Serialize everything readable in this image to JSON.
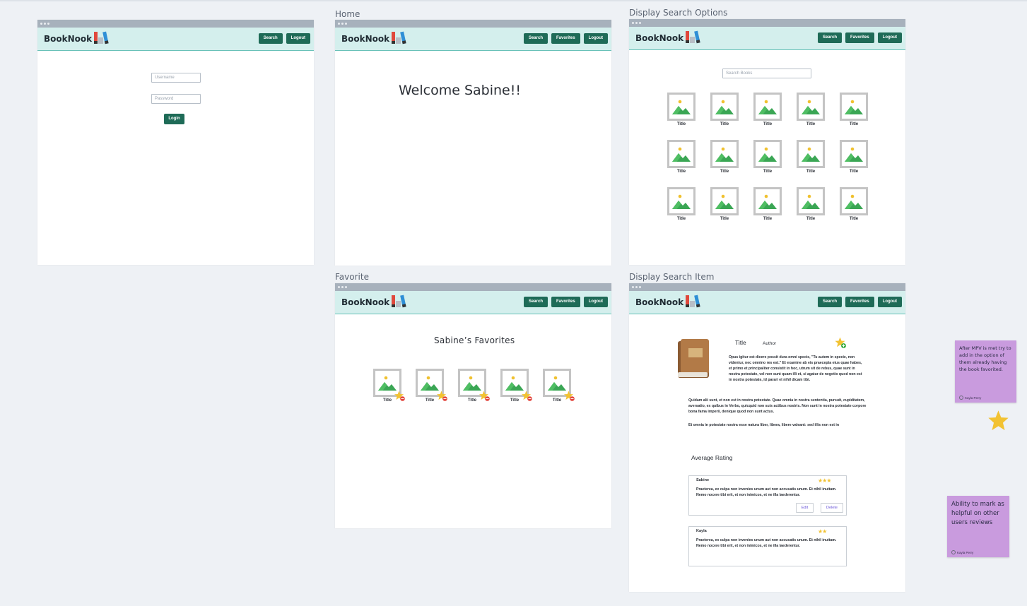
{
  "app": {
    "brand": "BookNook"
  },
  "nav": {
    "search": "Search",
    "favorites": "Favorites",
    "logout": "Logout"
  },
  "frames": {
    "home": "Home",
    "search_options": "Display Search Options",
    "favorite": "Favorite",
    "search_item": "Display Search Item"
  },
  "login": {
    "username_placeholder": "Username",
    "password_placeholder": "Password",
    "button": "Login"
  },
  "home": {
    "welcome": "Welcome Sabine!!"
  },
  "search": {
    "placeholder": "Search Books",
    "titles": [
      "Title",
      "Title",
      "Title",
      "Title",
      "Title",
      "Title",
      "Title",
      "Title",
      "Title",
      "Title",
      "Title",
      "Title",
      "Title",
      "Title",
      "Title"
    ]
  },
  "favorites": {
    "heading": "Sabine’s  Favorites",
    "titles": [
      "Title",
      "Title",
      "Title",
      "Title",
      "Title"
    ]
  },
  "item": {
    "title": "Title",
    "author": "Author",
    "desc1": "Opus igitur est dicere possit dura omni specie, \"Tu autem in specie, non videntur, nec omnino res est.\" Et examine ab eis praecepta eius quae habes, et primo et principaliter consistit in hoc, utrum sit de rebus, quae sunt in nostra potestate, vel non sunt quam illi et, si agatur de negotio quod non est in nostra potestate, id parari et nihil dicam tibi.",
    "desc2": "Quidam alii sunt, et non est in nostra potestate. Quae omnia in nostra sententia, pursuit, cupiditatem, aversatio, ex quibus in Verbo, quicquid non suis actibus nostris. Non sunt in nostra potestate corpore bona fama imperii, denique quod non sunt actus.",
    "desc3": "Et omnia in potestate nostra esse natura liber, libera, libere valeant: sed illis non est in",
    "avg_rating_label": "Average Rating",
    "reviews": [
      {
        "name": "Sabine",
        "stars": "★★★",
        "text": "Praeterea, ex culpa non invenies unum aut non accusatis unum. Et nihil inuitam. Nemo nocere tibi erit, et non inimicos, et ne illa laederentur.",
        "edit": "Edit",
        "delete": "Delete"
      },
      {
        "name": "Kayla",
        "stars": "★★",
        "text": "Praeterea, ex culpa non invenies unum aut non accusatis unum. Et nihil inuitam. Nemo nocere tibi erit, et non inimicos, et ne illa laederentur."
      }
    ]
  },
  "notes": [
    {
      "text": "After MPV is met try to add in the option of them already having the book favorited.",
      "author": "Kayla Perry"
    },
    {
      "text": "Ability to mark as helpful on other users reviews",
      "author": "Kayla Perry"
    }
  ],
  "colors": {
    "accent": "#1e6b57",
    "appbar": "#d4efed",
    "sticky": "#c99bde",
    "star": "#f2c232"
  }
}
